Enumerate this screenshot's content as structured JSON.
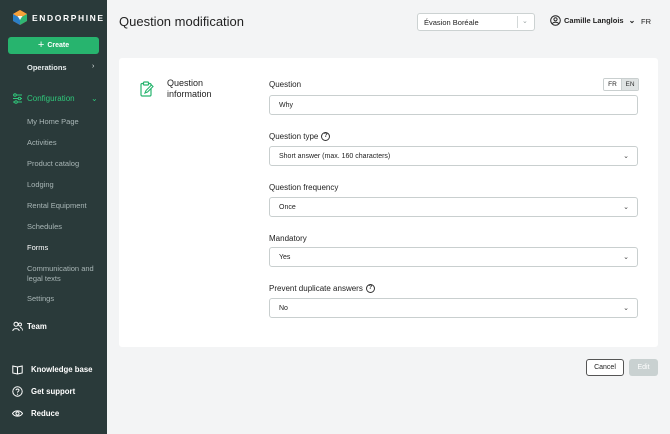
{
  "app": {
    "brand": "ENDORPHINE"
  },
  "sidebar": {
    "create_label": "Create",
    "operations_label": "Operations",
    "configuration_label": "Configuration",
    "config_items": [
      "My Home Page",
      "Activities",
      "Product catalog",
      "Lodging",
      "Rental Equipment",
      "Schedules",
      "Forms",
      "Communication and legal texts",
      "Settings"
    ],
    "team_label": "Team",
    "knowledge_label": "Knowledge base",
    "support_label": "Get support",
    "reduce_label": "Reduce"
  },
  "header": {
    "title": "Question modification",
    "org_select_value": "Évasion Boréale",
    "user_name": "Camille Langlois",
    "language": "FR"
  },
  "form": {
    "section_title": "Question information",
    "lang_fr": "FR",
    "lang_en": "EN",
    "question_label": "Question",
    "question_value": "Why",
    "type_label": "Question type",
    "type_value": "Short answer (max. 160 characters)",
    "frequency_label": "Question frequency",
    "frequency_value": "Once",
    "mandatory_label": "Mandatory",
    "mandatory_value": "Yes",
    "duplicate_label": "Prevent duplicate answers",
    "duplicate_value": "No",
    "help_glyph": "?"
  },
  "actions": {
    "cancel": "Cancel",
    "edit": "Edit"
  },
  "colors": {
    "sidebar_bg": "#2a3a3a",
    "accent": "#27b46e",
    "active_nav": "#2fc77a"
  }
}
